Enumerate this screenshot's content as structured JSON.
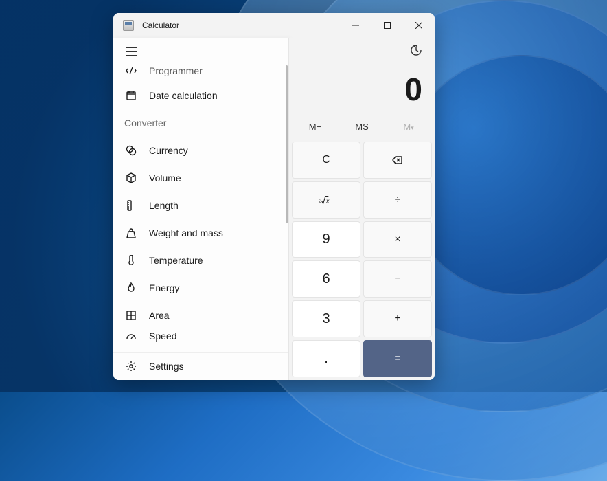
{
  "window": {
    "title": "Calculator"
  },
  "display": {
    "value": "0"
  },
  "memory": {
    "m_minus": "M−",
    "ms": "MS",
    "m_list": "M"
  },
  "nav": {
    "partial_top": "Programmer",
    "date_calc": "Date calculation",
    "section_converter": "Converter",
    "currency": "Currency",
    "volume": "Volume",
    "length": "Length",
    "weight": "Weight and mass",
    "temperature": "Temperature",
    "energy": "Energy",
    "area": "Area",
    "speed": "Speed",
    "settings": "Settings"
  },
  "keys": {
    "clear": "C",
    "divide": "÷",
    "multiply": "×",
    "minus": "−",
    "plus": "+",
    "equals": "=",
    "dot": ".",
    "nine": "9",
    "six": "6",
    "three": "3"
  }
}
